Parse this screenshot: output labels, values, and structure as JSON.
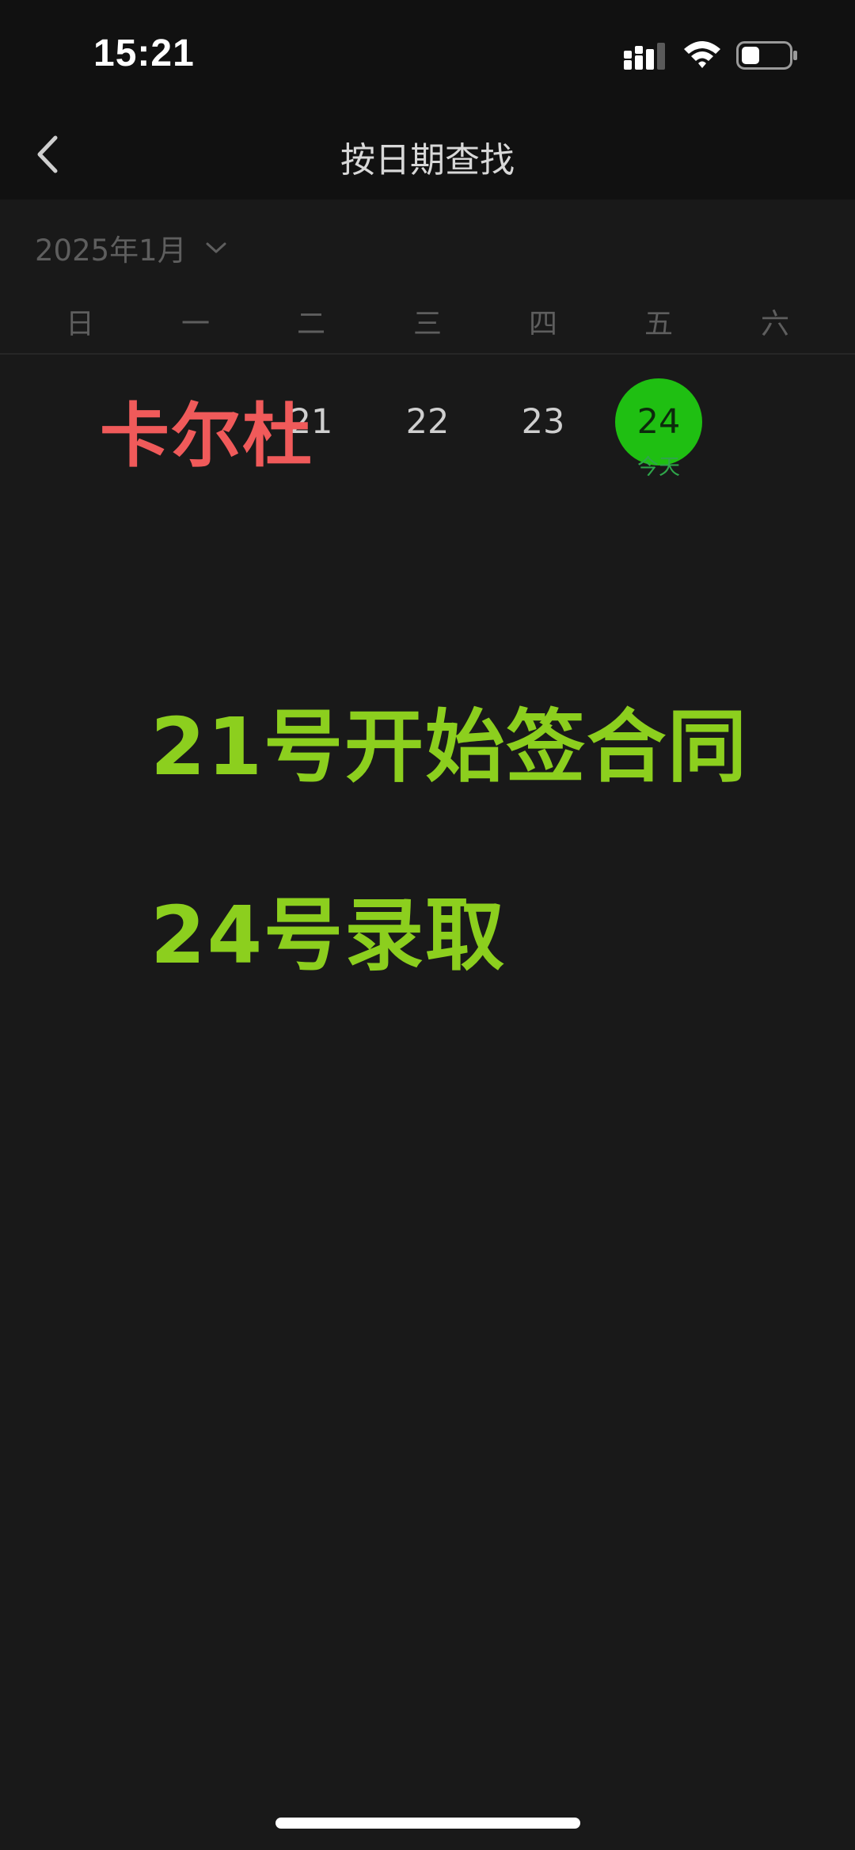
{
  "status_bar": {
    "time": "15:21",
    "signal_icon": "cellular-signal-icon",
    "wifi_icon": "wifi-icon",
    "battery_icon": "battery-icon",
    "battery_level": 0.35
  },
  "nav": {
    "back_icon": "chevron-left-icon",
    "title": "按日期查找"
  },
  "calendar": {
    "month_label": "2025年1月",
    "weekdays": [
      "日",
      "一",
      "二",
      "三",
      "四",
      "五",
      "六"
    ],
    "days": [
      "21",
      "22",
      "23",
      "24"
    ],
    "today_label": "今天"
  },
  "overlay": {
    "red_text": "卡尔杜",
    "line1": "21号开始签合同",
    "line2": "24号录取"
  },
  "colors": {
    "background": "#191919",
    "bar_background": "#111111",
    "today_circle": "#1fbf12",
    "overlay_red": "#f05a5a",
    "overlay_green": "#8ccf1e"
  }
}
